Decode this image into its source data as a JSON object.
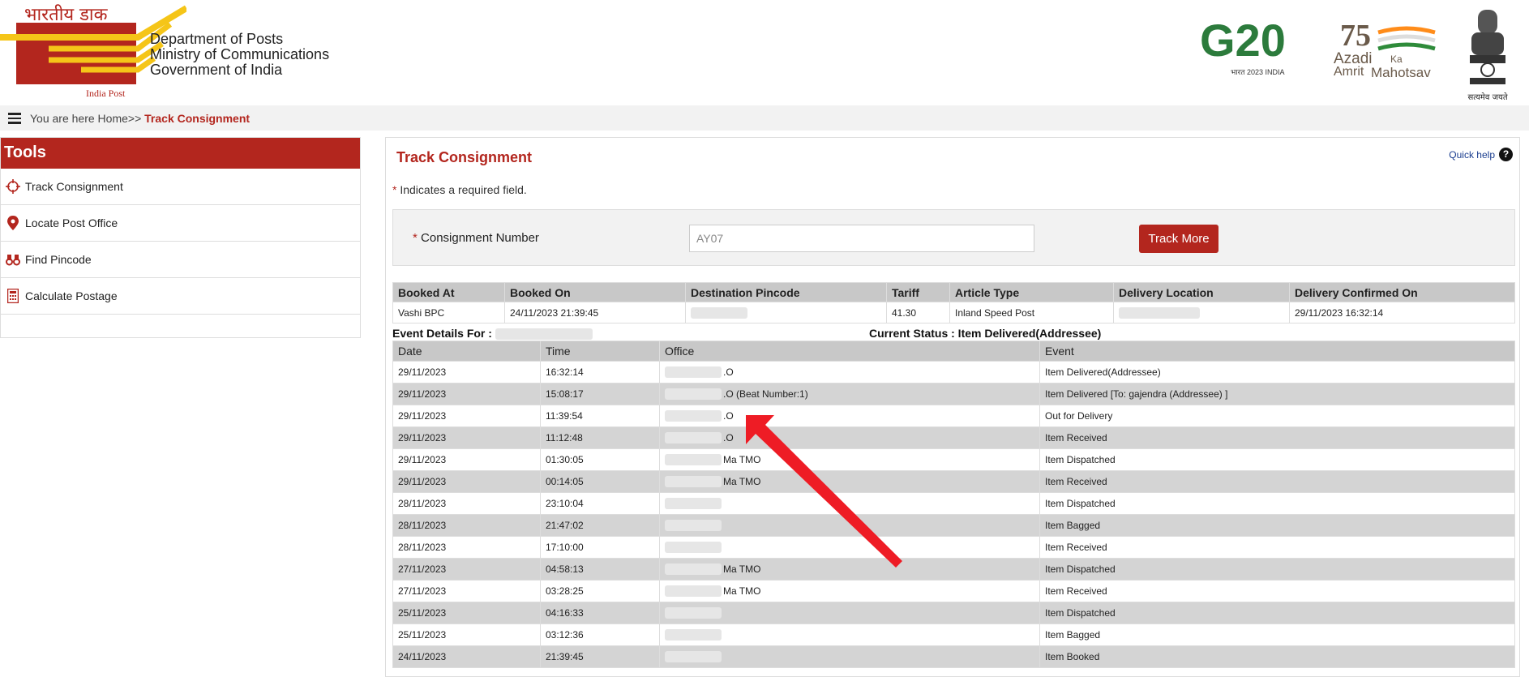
{
  "header": {
    "logo_hindi": "भारतीय डाक",
    "logo_english": "India Post",
    "dept_lines": [
      "Department of Posts",
      "Ministry of Communications",
      "Government of India"
    ],
    "g20_text": "G20",
    "g20_tagline": "भारत 2023 INDIA",
    "azadi_75": "75",
    "azadi_line1": "Azadi",
    "azadi_ka": "Ka",
    "azadi_amrit": "Amrit",
    "azadi_mahotsav": "Mahotsav",
    "emblem_text": "सत्यमेव जयते"
  },
  "breadcrumb": {
    "prefix": "You are here Home>> ",
    "current": "Track Consignment"
  },
  "sidebar": {
    "title": "Tools",
    "items": [
      {
        "label": "Track Consignment",
        "icon": "crosshair-icon"
      },
      {
        "label": "Locate Post Office",
        "icon": "map-pin-icon"
      },
      {
        "label": "Find Pincode",
        "icon": "binoculars-icon"
      },
      {
        "label": "Calculate Postage",
        "icon": "calculator-icon"
      }
    ]
  },
  "main": {
    "title": "Track Consignment",
    "quick_help": "Quick help",
    "required_note": "Indicates a required field.",
    "consignment_label": "Consignment Number",
    "consignment_value": "AY07",
    "track_button": "Track More",
    "booking": {
      "headers": [
        "Booked At",
        "Booked On",
        "Destination Pincode",
        "Tariff",
        "Article Type",
        "Delivery Location",
        "Delivery Confirmed On"
      ],
      "row": [
        "Vashi BPC",
        "24/11/2023 21:39:45",
        "",
        "41.30",
        "Inland Speed Post",
        "",
        "29/11/2023 16:32:14"
      ]
    },
    "event_for_label": "Event Details For :",
    "current_status": "Current Status : Item Delivered(Addressee)",
    "events": {
      "headers": [
        "Date",
        "Time",
        "Office",
        "Event"
      ],
      "rows": [
        {
          "date": "29/11/2023",
          "time": "16:32:14",
          "office": ".O",
          "event": "Item Delivered(Addressee)"
        },
        {
          "date": "29/11/2023",
          "time": "15:08:17",
          "office": ".O (Beat Number:1)",
          "event": "Item Delivered [To: gajendra (Addressee) ]"
        },
        {
          "date": "29/11/2023",
          "time": "11:39:54",
          "office": ".O",
          "event": "Out for Delivery"
        },
        {
          "date": "29/11/2023",
          "time": "11:12:48",
          "office": ".O",
          "event": "Item Received"
        },
        {
          "date": "29/11/2023",
          "time": "01:30:05",
          "office": "Ma TMO",
          "event": "Item Dispatched"
        },
        {
          "date": "29/11/2023",
          "time": "00:14:05",
          "office": "Ma TMO",
          "event": "Item Received"
        },
        {
          "date": "28/11/2023",
          "time": "23:10:04",
          "office": "",
          "event": "Item Dispatched"
        },
        {
          "date": "28/11/2023",
          "time": "21:47:02",
          "office": "",
          "event": "Item Bagged"
        },
        {
          "date": "28/11/2023",
          "time": "17:10:00",
          "office": "",
          "event": "Item Received"
        },
        {
          "date": "27/11/2023",
          "time": "04:58:13",
          "office": "Ma TMO",
          "event": "Item Dispatched"
        },
        {
          "date": "27/11/2023",
          "time": "03:28:25",
          "office": "Ma TMO",
          "event": "Item Received"
        },
        {
          "date": "25/11/2023",
          "time": "04:16:33",
          "office": "",
          "event": "Item Dispatched"
        },
        {
          "date": "25/11/2023",
          "time": "03:12:36",
          "office": "",
          "event": "Item Bagged"
        },
        {
          "date": "24/11/2023",
          "time": "21:39:45",
          "office": "",
          "event": "Item Booked"
        }
      ]
    }
  },
  "colors": {
    "brand_red": "#b3261e",
    "table_header_gray": "#c8c8c8",
    "row_alt_gray": "#d4d4d4",
    "annotation_arrow": "#ee1c25"
  }
}
